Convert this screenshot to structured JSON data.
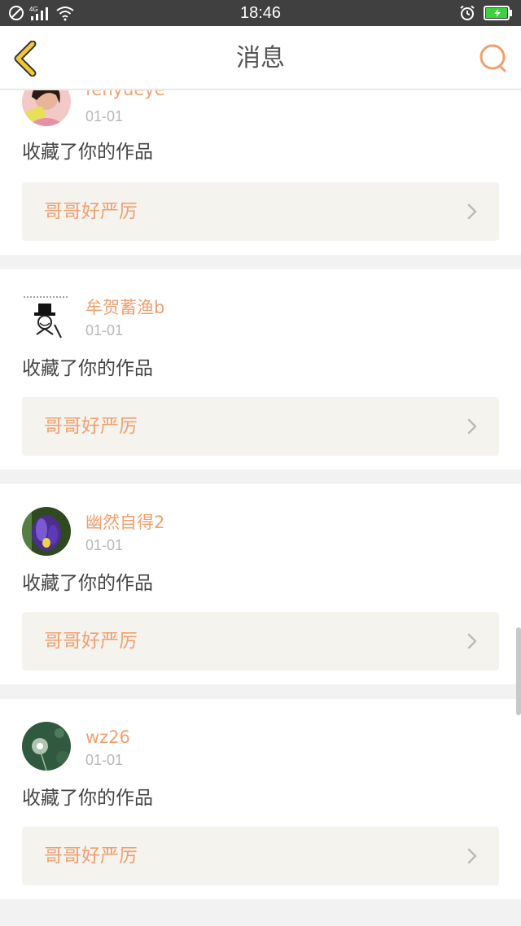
{
  "status_bar": {
    "time": "18:46",
    "network": "4G",
    "battery_color": "#3dd13d"
  },
  "nav": {
    "title": "消息",
    "back_icon": "chevron-left-icon",
    "search_icon": "search-icon",
    "accent": "#f0a070",
    "back_color": "#f2c830"
  },
  "messages": [
    {
      "username": "fenyueye",
      "date": "01-01",
      "action": "收藏了你的作品",
      "work_title": "哥哥好严厉"
    },
    {
      "username": "牟贺蓄渔b",
      "date": "01-01",
      "action": "收藏了你的作品",
      "work_title": "哥哥好严厉"
    },
    {
      "username": "幽然自得2",
      "date": "01-01",
      "action": "收藏了你的作品",
      "work_title": "哥哥好严厉"
    },
    {
      "username": "wz26",
      "date": "01-01",
      "action": "收藏了你的作品",
      "work_title": "哥哥好严厉"
    }
  ]
}
